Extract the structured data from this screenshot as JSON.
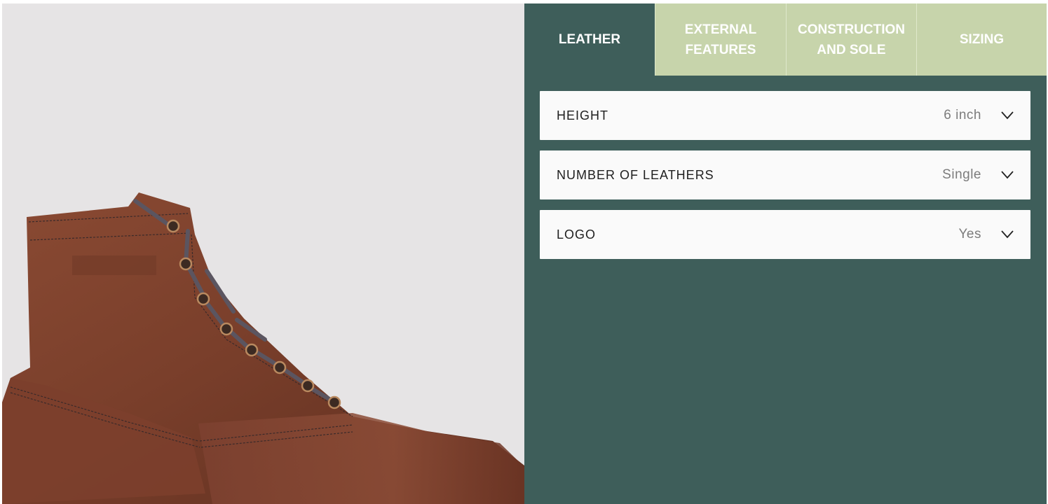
{
  "tabs": [
    {
      "label": "LEATHER"
    },
    {
      "label": "EXTERNAL\nFEATURES"
    },
    {
      "label": "CONSTRUCTION\nAND SOLE"
    },
    {
      "label": "SIZING"
    }
  ],
  "active_tab": "LEATHER",
  "options": [
    {
      "label": "HEIGHT",
      "value": "6 inch",
      "icon": "chevron-down-icon"
    },
    {
      "label": "NUMBER OF LEATHERS",
      "value": "Single",
      "icon": "chevron-down-icon"
    },
    {
      "label": "LOGO",
      "value": "Yes",
      "icon": "chevron-down-icon"
    }
  ],
  "colors": {
    "panel": "#3e5e5a",
    "tab_inactive": "#c7d4ab",
    "viewer_bg": "#e6e4e5",
    "boot_leather": "#7a3f2b"
  }
}
